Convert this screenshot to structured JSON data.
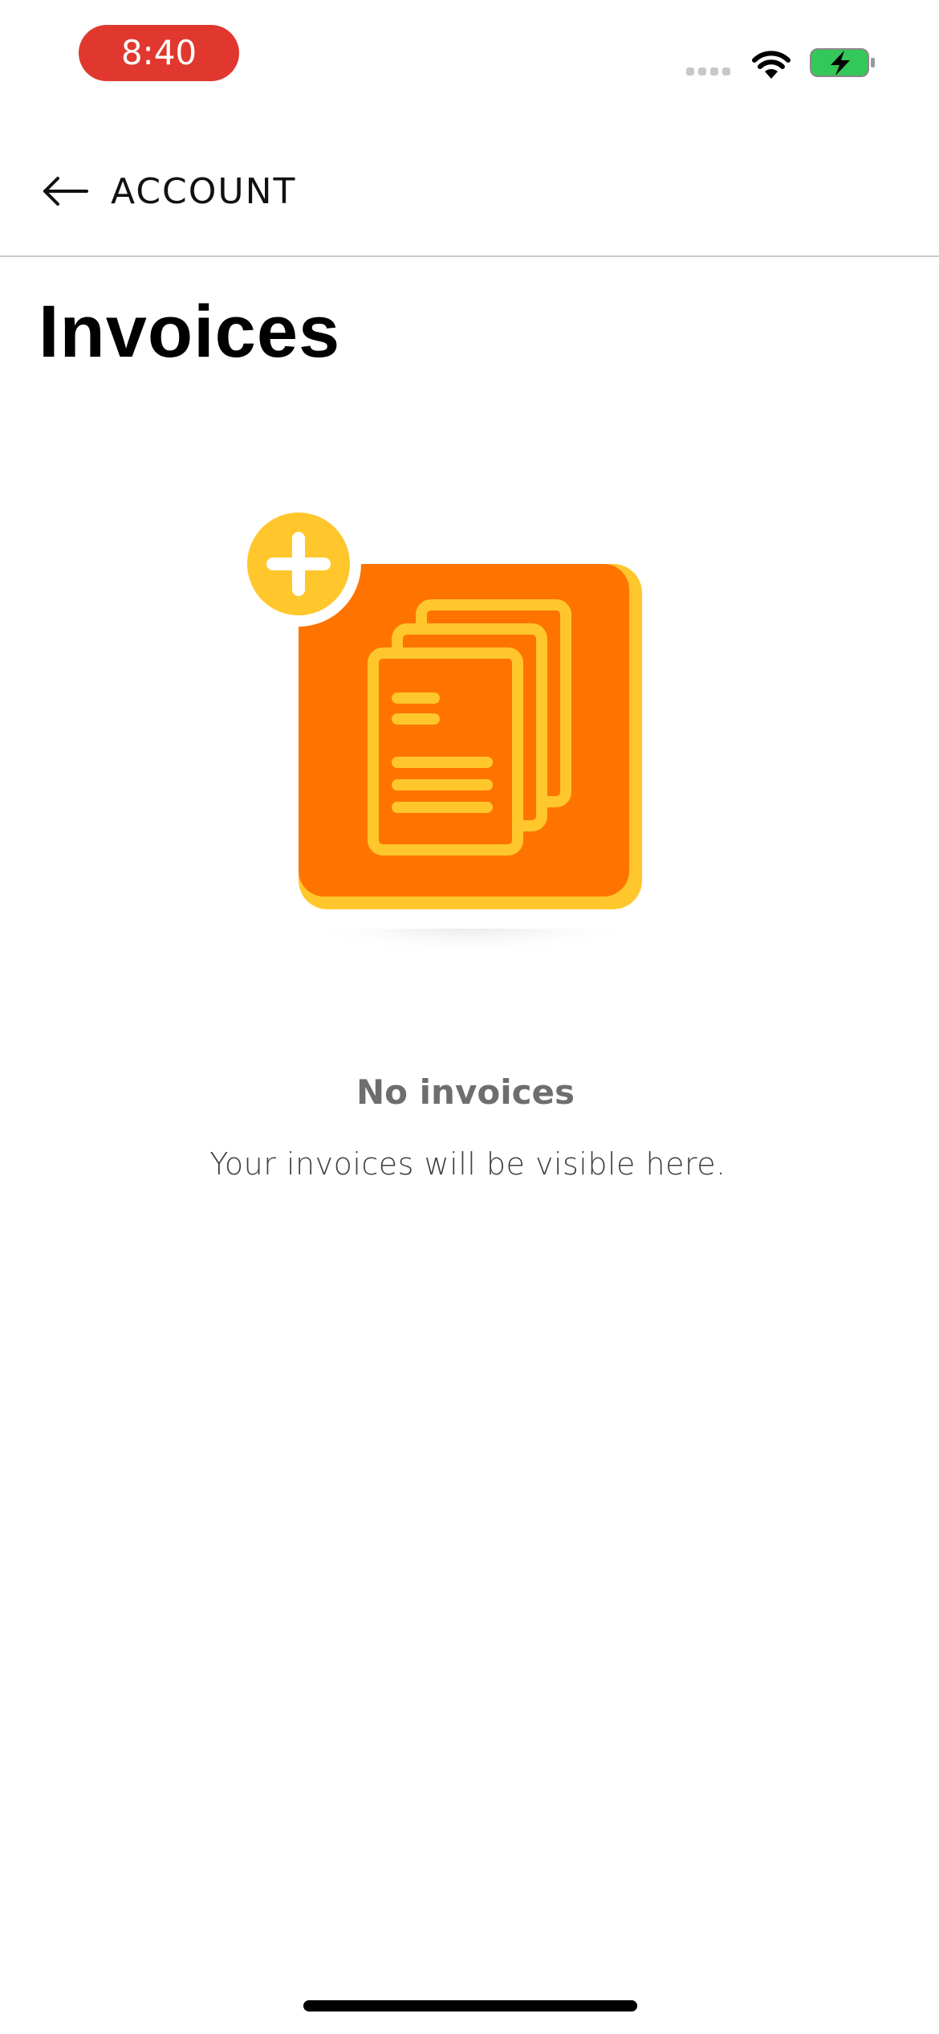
{
  "status_bar": {
    "time": "8:40",
    "time_pill_color": "#e0382e",
    "icons": [
      "signal-icon",
      "wifi-icon",
      "battery-charging-icon"
    ],
    "battery_color": "#34c759"
  },
  "nav": {
    "back_label": "ACCOUNT",
    "back_icon": "arrow-left-icon"
  },
  "page": {
    "title": "Invoices"
  },
  "empty_state": {
    "illustration": "invoices-empty-illustration",
    "accent_orange": "#ff7300",
    "accent_yellow": "#ffc72c",
    "title": "No invoices",
    "subtitle": "Your invoices will be visible here."
  }
}
